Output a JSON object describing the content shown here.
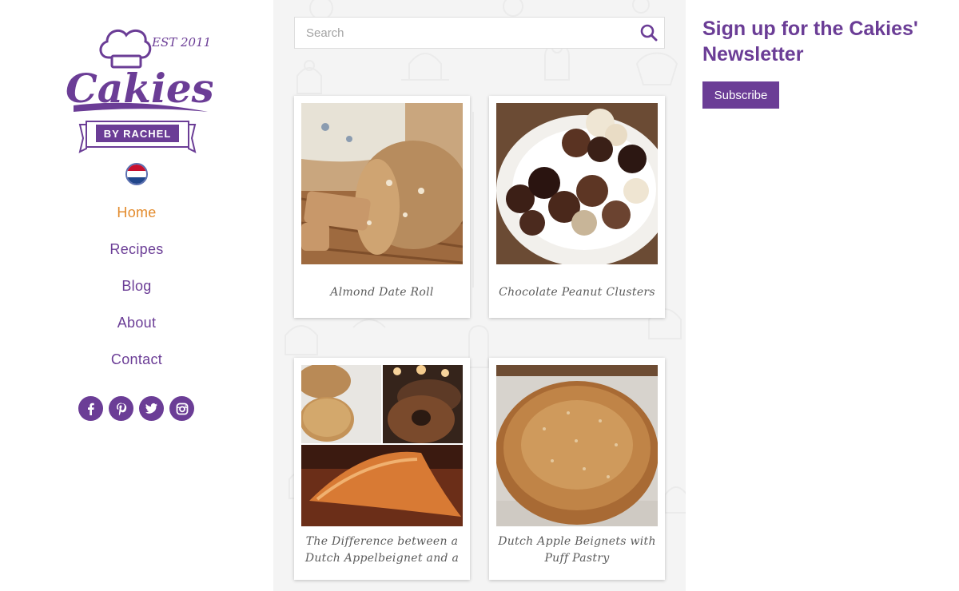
{
  "brand": {
    "name": "Cakies",
    "established": "EST 2011",
    "byline": "BY RACHEL",
    "color": "#6b3d96"
  },
  "language": {
    "flag": "netherlands-flag",
    "colors": [
      "#c8102e",
      "#ffffff",
      "#21468b"
    ]
  },
  "nav": {
    "items": [
      {
        "label": "Home",
        "active": true
      },
      {
        "label": "Recipes",
        "active": false
      },
      {
        "label": "Blog",
        "active": false
      },
      {
        "label": "About",
        "active": false
      },
      {
        "label": "Contact",
        "active": false
      }
    ],
    "active_color": "#e38b2c"
  },
  "social": [
    "facebook-icon",
    "pinterest-icon",
    "twitter-icon",
    "instagram-icon"
  ],
  "search": {
    "placeholder": "Search",
    "value": ""
  },
  "cards": [
    {
      "title": "Almond Date Roll",
      "image": "almond-date-roll-photo"
    },
    {
      "title": "Chocolate Peanut Clusters",
      "image": "chocolate-peanut-clusters-photo"
    },
    {
      "title": "The Difference between a Dutch Appelbeignet and a",
      "image": "appelbeignet-collage-photo"
    },
    {
      "title": "Dutch Apple Beignets with Puff Pastry",
      "image": "dutch-apple-beignet-photo"
    }
  ],
  "newsletter": {
    "title": "Sign up for the Cakies' Newsletter",
    "button": "Subscribe"
  }
}
